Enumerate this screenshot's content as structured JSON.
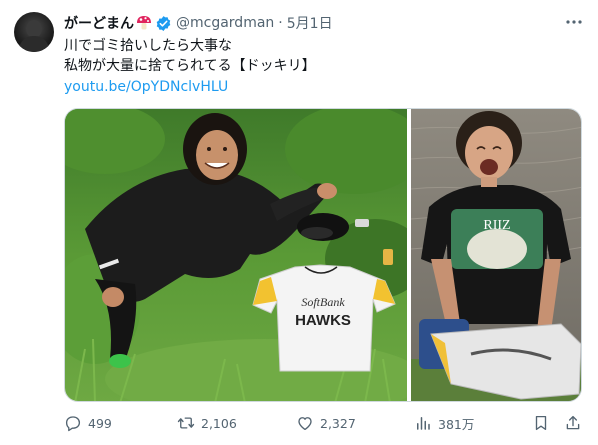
{
  "tweet": {
    "display_name": "がーどまん",
    "handle": "@mcgardman",
    "separator": "·",
    "date": "5月1日",
    "text_line1": "川でゴミ拾いしたら大事な",
    "text_line2": "私物が大量に捨てられてる【ドッキリ】",
    "link": "youtu.be/OpYDNclvHLU",
    "verified": true
  },
  "media": {
    "photo_left_jersey_top": "SoftBank",
    "photo_left_jersey_bottom": "HAWKS",
    "photo_right_shirt_text": "RIIZ"
  },
  "actions": {
    "reply_count": "499",
    "repost_count": "2,106",
    "like_count": "2,327",
    "views_count": "381万"
  },
  "colors": {
    "text": "#0f1419",
    "secondary": "#536471",
    "link": "#1d9bf0",
    "verified": "#1d9bf0",
    "border": "#cfd9de"
  },
  "icons": [
    "more-icon",
    "verified-badge-icon",
    "mushroom-emoji",
    "reply-icon",
    "repost-icon",
    "like-icon",
    "views-icon",
    "bookmark-icon",
    "share-icon"
  ]
}
